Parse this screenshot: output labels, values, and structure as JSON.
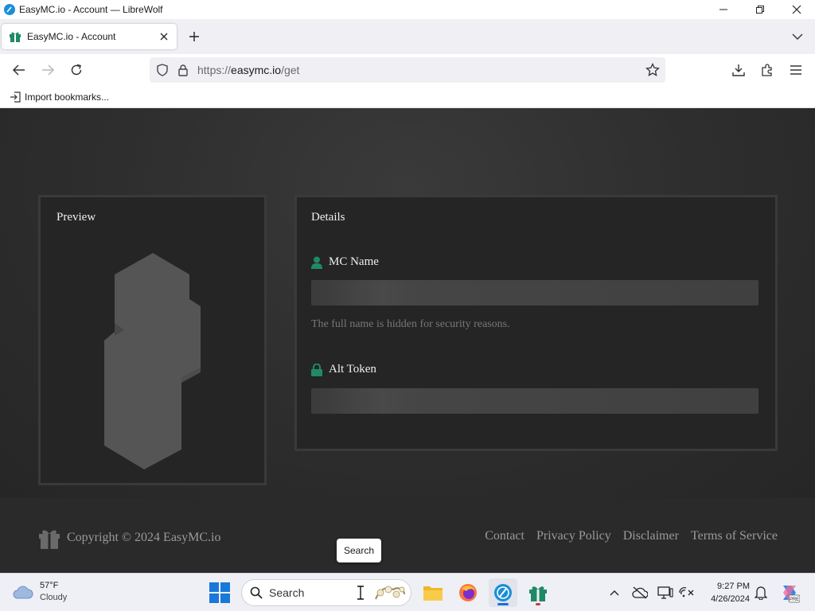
{
  "window": {
    "title": "EasyMC.io - Account — LibreWolf"
  },
  "tab": {
    "title": "EasyMC.io - Account"
  },
  "navbar": {
    "url_scheme": "https://",
    "url_host": "easymc.io",
    "url_path": "/get"
  },
  "bookmarks": {
    "import_label": "Import bookmarks..."
  },
  "preview": {
    "title": "Preview"
  },
  "details": {
    "title": "Details",
    "mc_name_label": "MC Name",
    "mc_name_help": "The full name is hidden for security reasons.",
    "alt_token_label": "Alt Token"
  },
  "footer": {
    "copyright": "Copyright © 2024 EasyMC.io",
    "links": [
      "Contact",
      "Privacy Policy",
      "Disclaimer",
      "Terms of Service"
    ],
    "tooltip": "Search"
  },
  "taskbar": {
    "weather_temp": "57°F",
    "weather_cond": "Cloudy",
    "search_label": "Search",
    "time": "9:27 PM",
    "date": "4/26/2024"
  },
  "colors": {
    "accent_green": "#1f8a65",
    "page_bg": "#2e2e2e",
    "card_bg": "#252525"
  }
}
